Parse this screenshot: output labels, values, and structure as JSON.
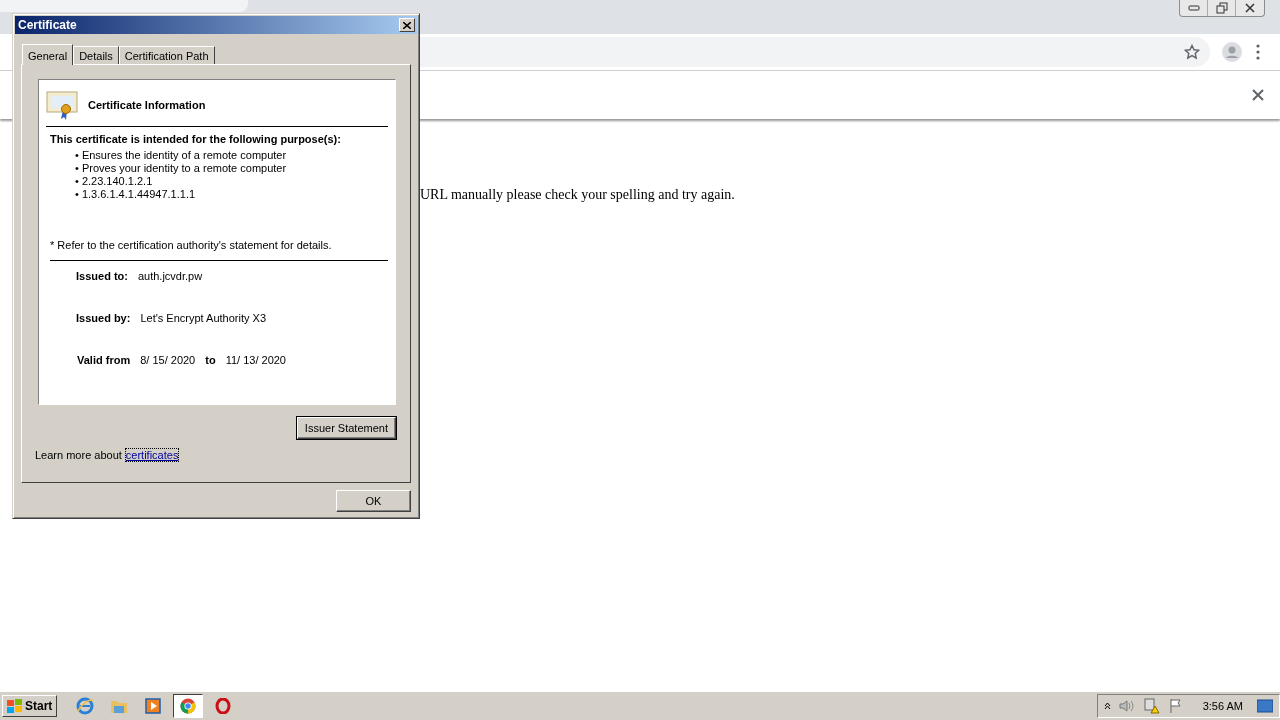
{
  "page": {
    "message": "URL manually please check your spelling and try again."
  },
  "dialog": {
    "title": "Certificate",
    "tabs": [
      {
        "label": "General",
        "selected": true
      },
      {
        "label": "Details",
        "selected": false
      },
      {
        "label": "Certification Path",
        "selected": false
      }
    ],
    "heading": "Certificate Information",
    "purpose_heading": "This certificate is intended for the following purpose(s):",
    "purposes": [
      "• Ensures the identity of a remote computer",
      "• Proves your identity to a remote computer",
      "• 2.23.140.1.2.1",
      "• 1.3.6.1.4.1.44947.1.1.1"
    ],
    "note": "* Refer to the certification authority's statement for details.",
    "issued_to": {
      "label": "Issued to:",
      "value": "auth.jcvdr.pw"
    },
    "issued_by": {
      "label": "Issued by:",
      "value": "Let's Encrypt Authority X3"
    },
    "validity": {
      "from_label": "Valid from",
      "from": "8/ 15/ 2020",
      "to_label": "to",
      "to": "11/ 13/ 2020"
    },
    "issuer_button": "Issuer Statement",
    "learn_more": {
      "text": "Learn more about",
      "link": "certificates"
    },
    "ok_button": "OK"
  },
  "taskbar": {
    "start": "Start",
    "apps": [
      {
        "kind": "ie",
        "selected": false
      },
      {
        "kind": "folder",
        "selected": false
      },
      {
        "kind": "media",
        "selected": false
      },
      {
        "kind": "chrome",
        "selected": true
      },
      {
        "kind": "opera",
        "selected": false
      }
    ],
    "clock": "3:56 AM"
  }
}
